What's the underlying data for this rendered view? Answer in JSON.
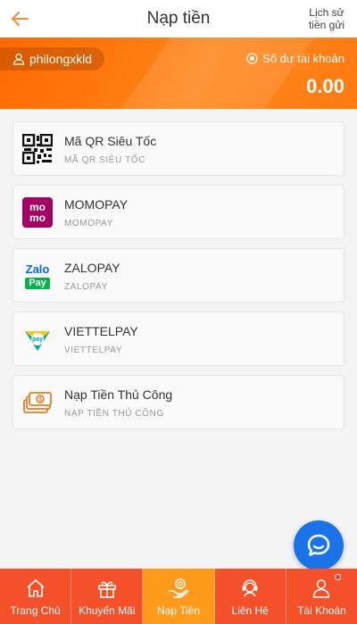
{
  "header": {
    "title": "Nạp tiền",
    "history_line1": "Lịch sử",
    "history_line2": "tiền gửi",
    "back_icon": "arrow-left-icon"
  },
  "account": {
    "username": "philongxkld",
    "balance_label": "Số dư tài khoản",
    "balance": "0.00"
  },
  "colors": {
    "accent": "#ff7a10",
    "nav": "#f4502a",
    "nav_active": "#ff9a1a",
    "chat": "#1a73e8"
  },
  "methods": [
    {
      "name": "Mã QR Siêu Tốc",
      "sub": "MÃ QR SIÊU TỐC",
      "icon": "qr-code-icon"
    },
    {
      "name": "MOMOPAY",
      "sub": "MOMOPAY",
      "icon": "momo-logo-icon"
    },
    {
      "name": "ZALOPAY",
      "sub": "ZALOPAY",
      "icon": "zalopay-logo-icon"
    },
    {
      "name": "VIETTELPAY",
      "sub": "VIETTELPAY",
      "icon": "viettelpay-logo-icon"
    },
    {
      "name": "Nạp Tiền Thủ Công",
      "sub": "NẠP TIỀN THỦ CÔNG",
      "icon": "cash-icon"
    }
  ],
  "nav": [
    {
      "label": "Trang Chủ",
      "icon": "home-icon",
      "active": false
    },
    {
      "label": "Khuyến Mãi",
      "icon": "gift-icon",
      "active": false
    },
    {
      "label": "Nạp Tiền",
      "icon": "deposit-hand-icon",
      "active": true
    },
    {
      "label": "Liên Hệ",
      "icon": "headset-icon",
      "active": false
    },
    {
      "label": "Tài Khoản",
      "icon": "user-icon",
      "active": false
    }
  ],
  "logos": {
    "momo_top": "mo",
    "momo_bottom": "mo",
    "zalo_top": "Zalo",
    "zalo_bottom": "Pay",
    "viettel_text": "pay"
  }
}
